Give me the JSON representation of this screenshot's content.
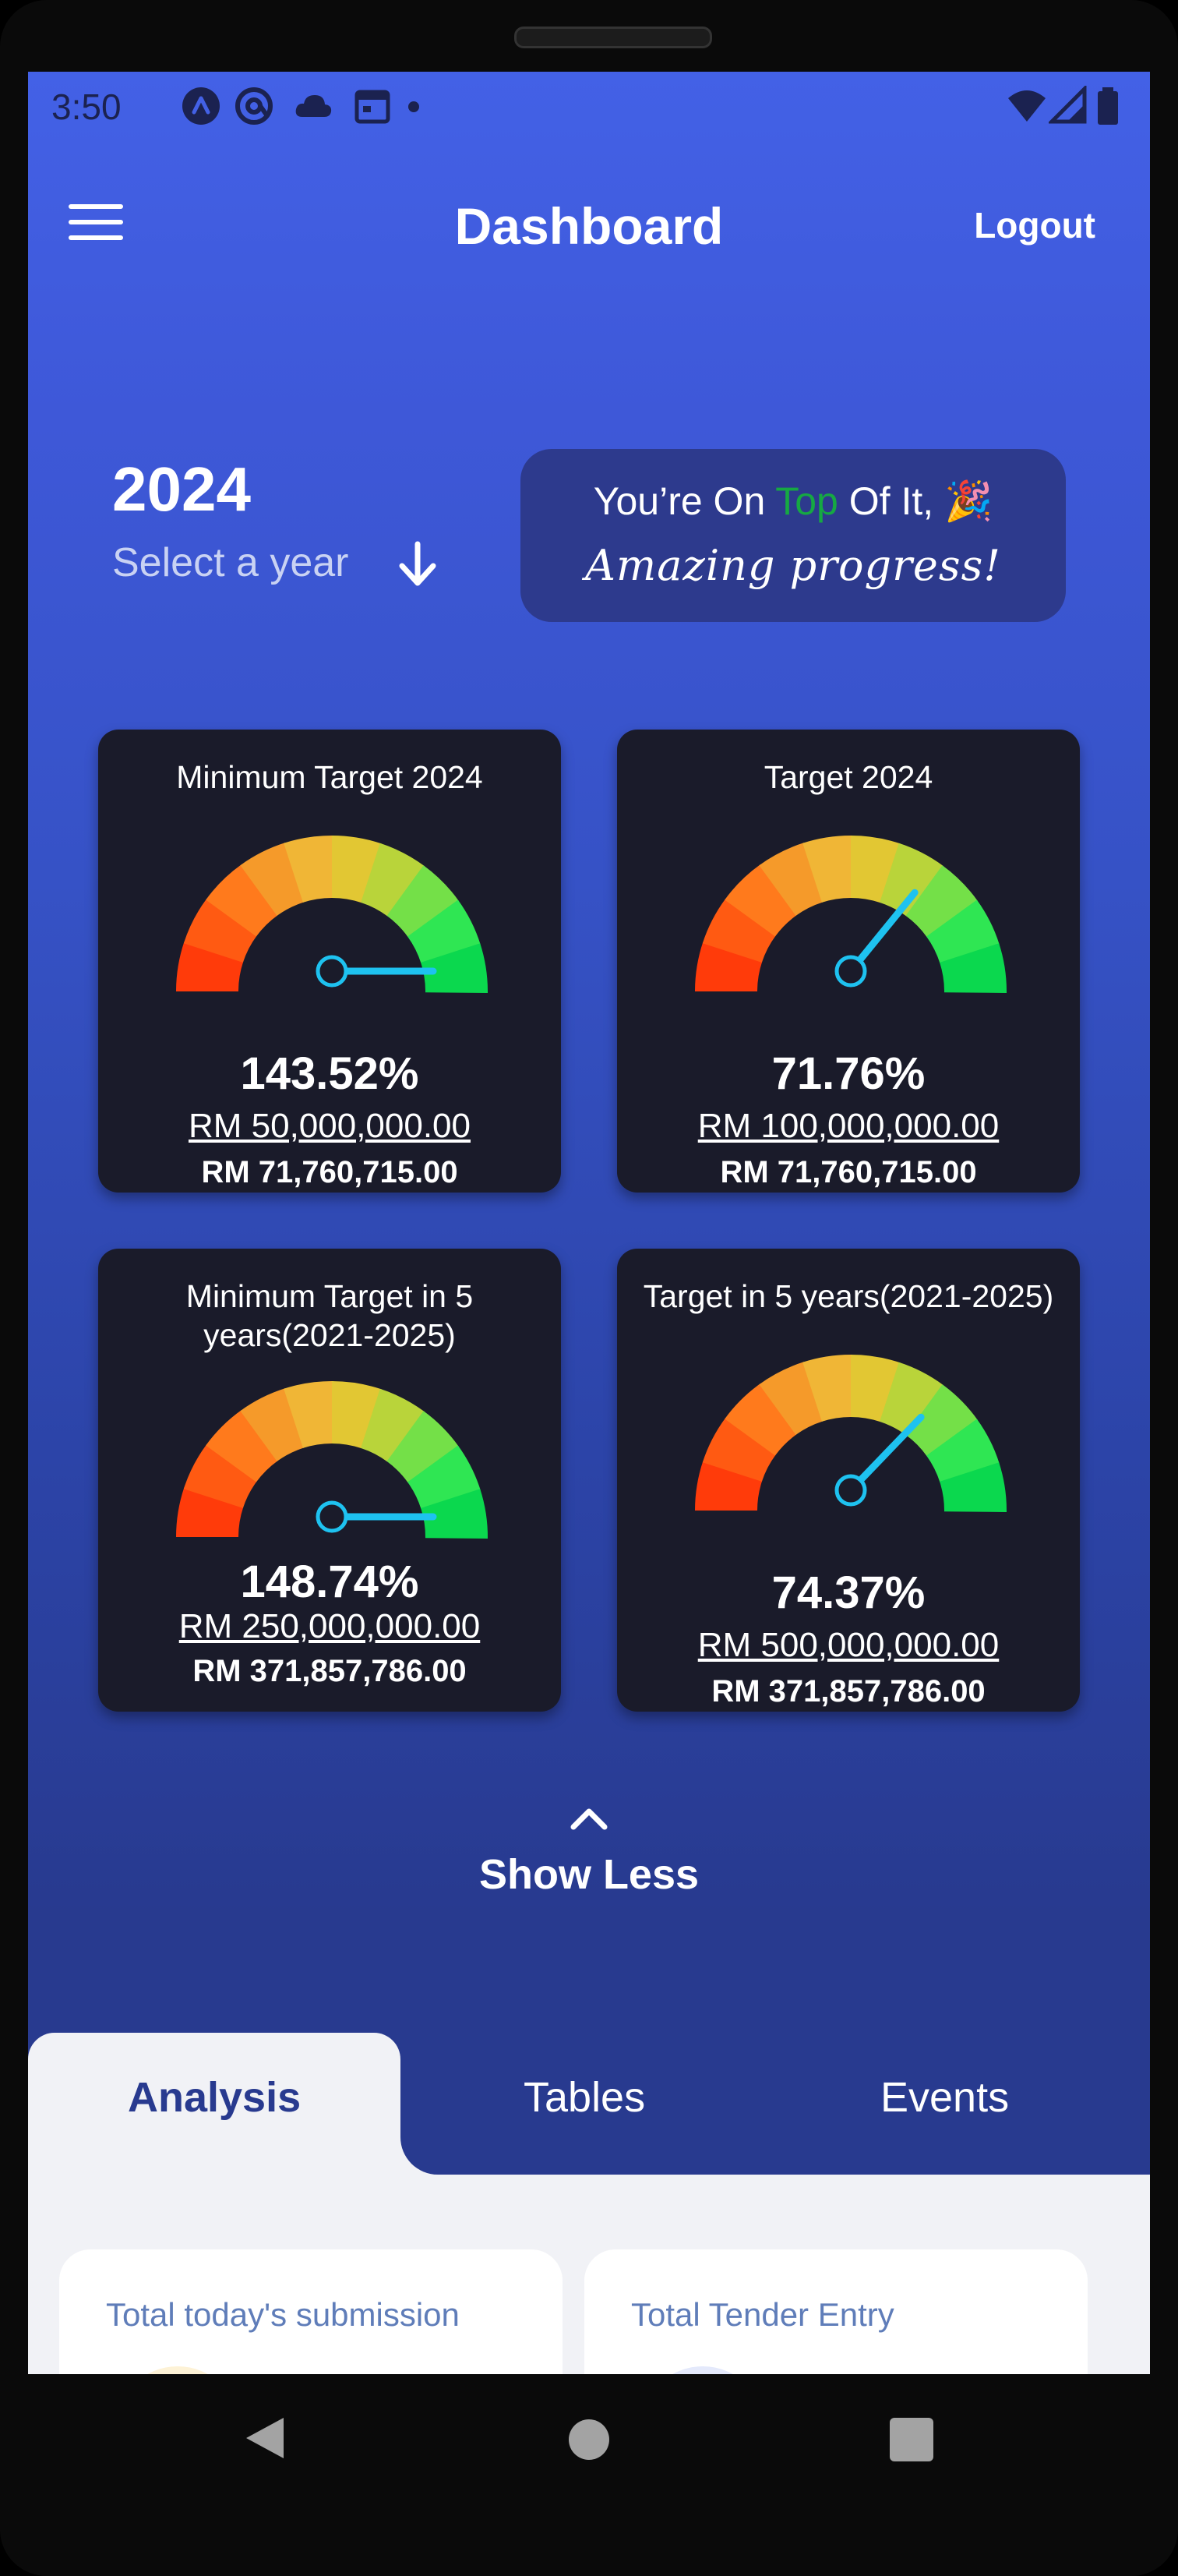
{
  "status_bar": {
    "time": "3:50",
    "icons": [
      "a-circle-icon",
      "at-sign-icon",
      "cloud-icon",
      "calendar-icon",
      "dot-icon",
      "wifi-icon",
      "signal-icon",
      "battery-icon"
    ]
  },
  "header": {
    "title": "Dashboard",
    "logout_label": "Logout"
  },
  "year_selector": {
    "year": "2024",
    "label": "Select a year"
  },
  "message": {
    "line1_before": "You’re On ",
    "line1_highlight": "Top",
    "line1_after": "  Of It, 🎉",
    "line2": "Amazing progress!",
    "highlight_color": "#16a843"
  },
  "gauges": [
    {
      "title": "Minimum Target 2024",
      "percent_text": "143.52%",
      "percent_value": 143.52,
      "target": "RM 50,000,000.00",
      "actual": "RM 71,760,715.00"
    },
    {
      "title": "Target 2024",
      "percent_text": "71.76%",
      "percent_value": 71.76,
      "target": "RM 100,000,000.00",
      "actual": "RM 71,760,715.00"
    },
    {
      "title": "Minimum Target in 5 years(2021-2025)",
      "percent_text": "148.74%",
      "percent_value": 148.74,
      "target": "RM 250,000,000.00",
      "actual": "RM 371,857,786.00"
    },
    {
      "title": "Target in 5 years(2021-2025)",
      "percent_text": "74.37%",
      "percent_value": 74.37,
      "target": "RM 500,000,000.00",
      "actual": "RM 371,857,786.00"
    }
  ],
  "toggle": {
    "label": "Show Less"
  },
  "tabs": [
    {
      "label": "Analysis",
      "active": true
    },
    {
      "label": "Tables",
      "active": false
    },
    {
      "label": "Events",
      "active": false
    }
  ],
  "stats": [
    {
      "title": "Total today's submission",
      "color": "#fdf2d6"
    },
    {
      "title": "Total Tender Entry",
      "color": "#e4e9fb"
    }
  ],
  "colors": {
    "accent": "#283a8f",
    "header_gradient_top": "#4361e6",
    "card_bg": "#1a1b2a",
    "needle": "#1ec2f0"
  }
}
